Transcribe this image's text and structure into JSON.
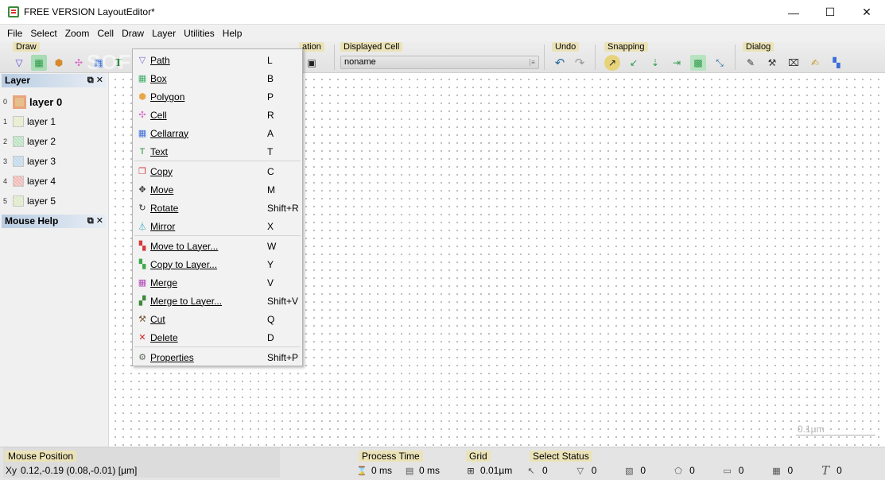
{
  "window": {
    "title": "FREE VERSION LayoutEditor*",
    "minimize_glyph": "—",
    "maximize_glyph": "☐",
    "close_glyph": "✕"
  },
  "menu": [
    "File",
    "Select",
    "Zoom",
    "Cell",
    "Draw",
    "Layer",
    "Utilities",
    "Help"
  ],
  "toolbar": {
    "draw_label": "Draw",
    "file_label_partial": "ation",
    "displayed_cell_label": "Displayed Cell",
    "displayed_cell_value": "noname",
    "undo_label": "Undo",
    "snapping_label": "Snapping",
    "dialog_label": "Dialog"
  },
  "watermark": "SOFTPEDIA",
  "layer_panel": {
    "title": "Layer",
    "layers": [
      {
        "num": "0",
        "label": "layer 0",
        "color": "#e6c08a",
        "selected": true
      },
      {
        "num": "1",
        "label": "layer 1",
        "color": "#e4ebc9"
      },
      {
        "num": "2",
        "label": "layer 2",
        "color": "#b8e3c0"
      },
      {
        "num": "3",
        "label": "layer 3",
        "color": "#c0d8ea"
      },
      {
        "num": "4",
        "label": "layer 4",
        "color": "#f0b8b4"
      },
      {
        "num": "5",
        "label": "layer 5",
        "color": "#dde9c6"
      }
    ]
  },
  "mouse_help_panel": {
    "title": "Mouse Help"
  },
  "draw_menu": {
    "items": [
      {
        "label": "Path",
        "shortcut": "L",
        "icon": "path-icon",
        "glyph": "▽",
        "color": "#7a6cd6"
      },
      {
        "label": "Box",
        "shortcut": "B",
        "icon": "box-icon",
        "glyph": "▦",
        "color": "#3cae6a"
      },
      {
        "label": "Polygon",
        "shortcut": "P",
        "icon": "polygon-icon",
        "glyph": "⬢",
        "color": "#e6a64a"
      },
      {
        "label": "Cell",
        "shortcut": "R",
        "icon": "cell-icon",
        "glyph": "✣",
        "color": "#d86cc8"
      },
      {
        "label": "Cellarray",
        "shortcut": "A",
        "icon": "cellarray-icon",
        "glyph": "▦",
        "color": "#3a6ed6"
      },
      {
        "label": "Text",
        "shortcut": "T",
        "icon": "text-icon",
        "glyph": "T",
        "color": "#2f8a3a"
      },
      {
        "label": "Copy",
        "shortcut": "C",
        "icon": "copy-icon",
        "glyph": "❐",
        "color": "#d63a3a"
      },
      {
        "label": "Move",
        "shortcut": "M",
        "icon": "move-icon",
        "glyph": "✥",
        "color": "#333333"
      },
      {
        "label": "Rotate",
        "shortcut": "Shift+R",
        "icon": "rotate-icon",
        "glyph": "↻",
        "color": "#333333"
      },
      {
        "label": "Mirror",
        "shortcut": "X",
        "icon": "mirror-icon",
        "glyph": "⏃",
        "color": "#2aa0b8"
      },
      {
        "label": "Move to Layer...",
        "shortcut": "W",
        "icon": "move-to-layer-icon",
        "glyph": "▚",
        "color": "#d63a3a"
      },
      {
        "label": "Copy to Layer...",
        "shortcut": "Y",
        "icon": "copy-to-layer-icon",
        "glyph": "▚",
        "color": "#3aa84a"
      },
      {
        "label": "Merge",
        "shortcut": "V",
        "icon": "merge-icon",
        "glyph": "▦",
        "color": "#b04ab8"
      },
      {
        "label": "Merge to Layer...",
        "shortcut": "Shift+V",
        "icon": "merge-to-layer-icon",
        "glyph": "▞",
        "color": "#3a8a3a"
      },
      {
        "label": "Cut",
        "shortcut": "Q",
        "icon": "cut-icon",
        "glyph": "⚒",
        "color": "#7a5a3a"
      },
      {
        "label": "Delete",
        "shortcut": "D",
        "icon": "delete-icon",
        "glyph": "✕",
        "color": "#d62020"
      },
      {
        "label": "Properties",
        "shortcut": "Shift+P",
        "icon": "properties-icon",
        "glyph": "⚙",
        "color": "#5a6a5a"
      }
    ]
  },
  "canvas": {
    "scale_label": "0.1µm"
  },
  "statusbar": {
    "mouse_position_label": "Mouse Position",
    "mouse_position_value": "0.12,-0.19 (0.08,-0.01) [µm]",
    "process_time_label": "Process Time",
    "process_time_1": "0 ms",
    "process_time_2": "0 ms",
    "grid_label": "Grid",
    "grid_value": "0.01µm",
    "select_status_label": "Select Status",
    "select_counts": [
      "0",
      "0",
      "0",
      "0",
      "0",
      "0",
      "0"
    ]
  }
}
